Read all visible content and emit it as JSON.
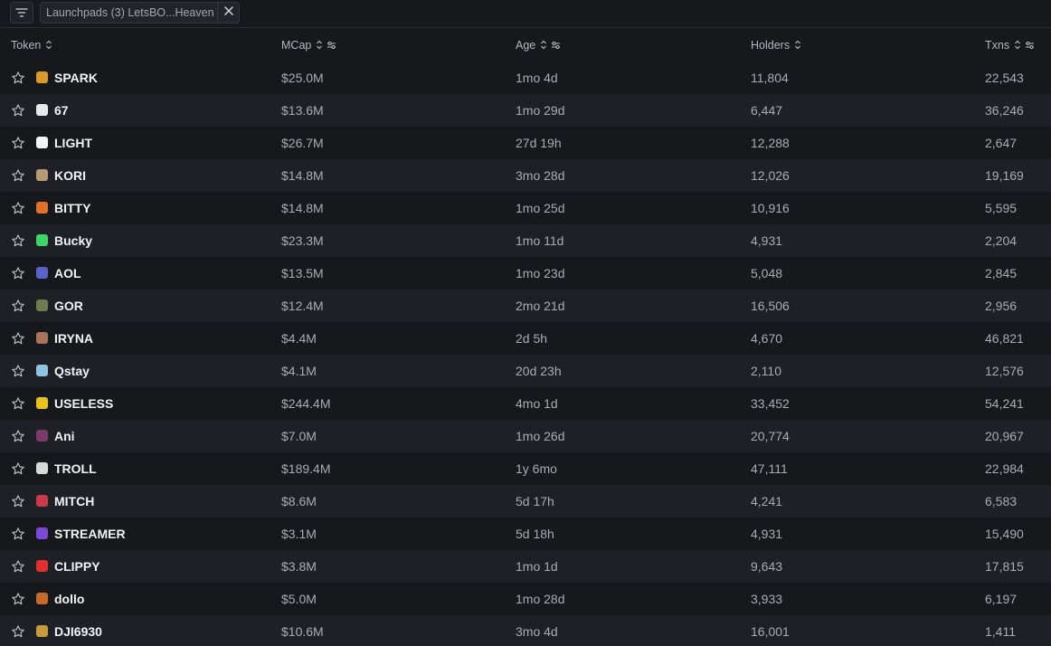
{
  "filter_bar": {
    "filter_icon": "filter-lines-icon",
    "chip_label": "Launchpads (3) LetsBO...Heaven",
    "chip_close_icon": "close-icon"
  },
  "columns": {
    "token": "Token",
    "mcap": "MCap",
    "age": "Age",
    "holders": "Holders",
    "txns": "Txns"
  },
  "colors": {
    "background": "#17181c",
    "row_alt": "#1e2026",
    "text_primary": "#f2f3f5",
    "text_secondary": "#a9acb3"
  },
  "rows": [
    {
      "name": "SPARK",
      "mcap": "$25.0M",
      "age": "1mo 4d",
      "holders": "11,804",
      "txns": "22,543",
      "avatar_color": "#d99a2b"
    },
    {
      "name": "67",
      "mcap": "$13.6M",
      "age": "1mo 29d",
      "holders": "6,447",
      "txns": "36,246",
      "avatar_color": "#e8e8ea"
    },
    {
      "name": "LIGHT",
      "mcap": "$26.7M",
      "age": "27d 19h",
      "holders": "12,288",
      "txns": "2,647",
      "avatar_color": "#f4f4f6"
    },
    {
      "name": "KORI",
      "mcap": "$14.8M",
      "age": "3mo 28d",
      "holders": "12,026",
      "txns": "19,169",
      "avatar_color": "#b59a74"
    },
    {
      "name": "BITTY",
      "mcap": "$14.8M",
      "age": "1mo 25d",
      "holders": "10,916",
      "txns": "5,595",
      "avatar_color": "#e0702a"
    },
    {
      "name": "Bucky",
      "mcap": "$23.3M",
      "age": "1mo 11d",
      "holders": "4,931",
      "txns": "2,204",
      "avatar_color": "#3fd36a"
    },
    {
      "name": "AOL",
      "mcap": "$13.5M",
      "age": "1mo 23d",
      "holders": "5,048",
      "txns": "2,845",
      "avatar_color": "#5a62c8"
    },
    {
      "name": "GOR",
      "mcap": "$12.4M",
      "age": "2mo 21d",
      "holders": "16,506",
      "txns": "2,956",
      "avatar_color": "#6f7a4e"
    },
    {
      "name": "IRYNA",
      "mcap": "$4.4M",
      "age": "2d 5h",
      "holders": "4,670",
      "txns": "46,821",
      "avatar_color": "#a9725a"
    },
    {
      "name": "Qstay",
      "mcap": "$4.1M",
      "age": "20d 23h",
      "holders": "2,110",
      "txns": "12,576",
      "avatar_color": "#8cc4e0"
    },
    {
      "name": "USELESS",
      "mcap": "$244.4M",
      "age": "4mo 1d",
      "holders": "33,452",
      "txns": "54,241",
      "avatar_color": "#e8c21f"
    },
    {
      "name": "Ani",
      "mcap": "$7.0M",
      "age": "1mo 26d",
      "holders": "20,774",
      "txns": "20,967",
      "avatar_color": "#7a3a6a"
    },
    {
      "name": "TROLL",
      "mcap": "$189.4M",
      "age": "1y 6mo",
      "holders": "47,111",
      "txns": "22,984",
      "avatar_color": "#d8d8d8"
    },
    {
      "name": "MITCH",
      "mcap": "$8.6M",
      "age": "5d 17h",
      "holders": "4,241",
      "txns": "6,583",
      "avatar_color": "#c83a4a"
    },
    {
      "name": "STREAMER",
      "mcap": "$3.1M",
      "age": "5d 18h",
      "holders": "4,931",
      "txns": "15,490",
      "avatar_color": "#7a4ad6"
    },
    {
      "name": "CLIPPY",
      "mcap": "$3.8M",
      "age": "1mo 1d",
      "holders": "9,643",
      "txns": "17,815",
      "avatar_color": "#e03030"
    },
    {
      "name": "dollo",
      "mcap": "$5.0M",
      "age": "1mo 28d",
      "holders": "3,933",
      "txns": "6,197",
      "avatar_color": "#c46a2a"
    },
    {
      "name": "DJI6930",
      "mcap": "$10.6M",
      "age": "3mo 4d",
      "holders": "16,001",
      "txns": "1,411",
      "avatar_color": "#c49a3a"
    }
  ]
}
